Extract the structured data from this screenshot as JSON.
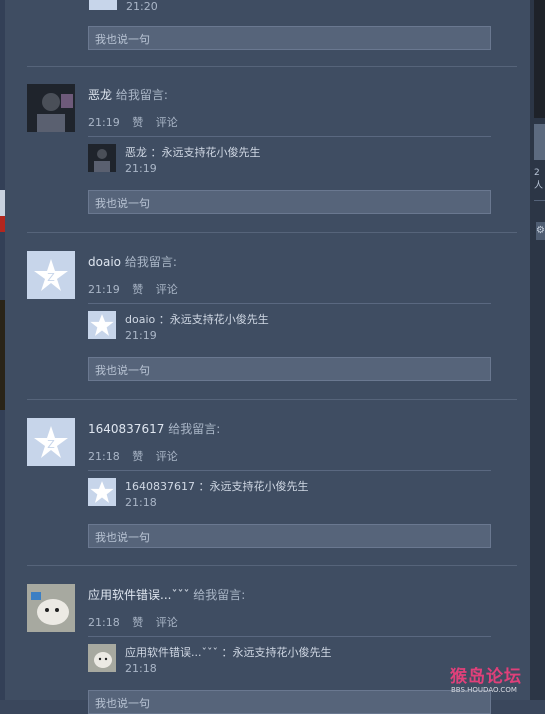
{
  "top_partial": {
    "time": "21:20",
    "comment_placeholder": "我也说一句"
  },
  "posts": [
    {
      "name": "恶龙",
      "action": "给我留言:",
      "time": "21:19",
      "like": "赞",
      "comment": "评论",
      "reply_text": "恶龙 ：永远支持花小俊先生",
      "reply_time": "21:19",
      "comment_placeholder": "我也说一句"
    },
    {
      "name": "doaio",
      "action": "给我留言:",
      "time": "21:19",
      "like": "赞",
      "comment": "评论",
      "reply_text": "doaio ：永远支持花小俊先生",
      "reply_time": "21:19",
      "comment_placeholder": "我也说一句"
    },
    {
      "name": "1640837617",
      "action": "给我留言:",
      "time": "21:18",
      "like": "赞",
      "comment": "评论",
      "reply_text": "1640837617 ：永远支持花小俊先生",
      "reply_time": "21:18",
      "comment_placeholder": "我也说一句"
    },
    {
      "name": "应用软件错误...ˇˇˇ",
      "action": "给我留言:",
      "time": "21:18",
      "like": "赞",
      "comment": "评论",
      "reply_text": "应用软件错误...ˇˇˇ ：永远支持花小俊先生",
      "reply_time": "21:18",
      "comment_placeholder": "我也说一句"
    }
  ],
  "right_panel_text": "2人",
  "watermark": {
    "title": "猴岛论坛",
    "url": "BBS.HOUDAO.COM"
  }
}
